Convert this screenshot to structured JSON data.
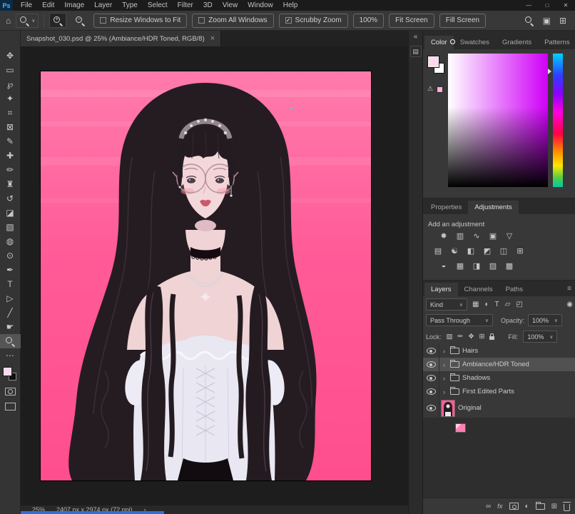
{
  "menubar": {
    "logo": "Ps",
    "items": [
      "File",
      "Edit",
      "Image",
      "Layer",
      "Type",
      "Select",
      "Filter",
      "3D",
      "View",
      "Window",
      "Help"
    ],
    "minimize": "—",
    "maximize": "□",
    "close": "✕"
  },
  "options_bar": {
    "checkboxes": [
      {
        "label": "Resize Windows to Fit",
        "checked": false
      },
      {
        "label": "Zoom All Windows",
        "checked": false
      },
      {
        "label": "Scrubby Zoom",
        "checked": true
      }
    ],
    "zoom_value": "100%",
    "fit_screen": "Fit Screen",
    "fill_screen": "Fill Screen"
  },
  "document_tab": {
    "title": "Snapshot_030.psd @ 25% (Ambiance/HDR Toned, RGB/8)",
    "close_label": "×"
  },
  "status_bar": {
    "zoom": "25%",
    "info": "2407 px x 2974 px (72 ppi)",
    "expander": "›"
  },
  "color_panel": {
    "tabs": [
      "Color",
      "Swatches",
      "Gradients",
      "Patterns"
    ],
    "active_tab": "Color"
  },
  "adjustments_panel": {
    "tabs": [
      "Properties",
      "Adjustments"
    ],
    "active_tab": "Adjustments",
    "header": "Add an adjustment",
    "icons_r1": [
      "✹",
      "▥",
      "∿",
      "▣",
      "▽"
    ],
    "icons_r2": [
      "▤",
      "☯",
      "◧",
      "◩",
      "◫",
      "⊞"
    ],
    "icons_r3": [
      "◒",
      "▦",
      "◨",
      "▨",
      "▩"
    ]
  },
  "layers_panel": {
    "tabs": [
      "Layers",
      "Channels",
      "Paths"
    ],
    "active_tab": "Layers",
    "kind_label": "Kind",
    "blend_mode": "Pass Through",
    "opacity_label": "Opacity:",
    "opacity_value": "100%",
    "lock_label": "Lock:",
    "fill_label": "Fill:",
    "fill_value": "100%",
    "fx_label": "fx",
    "layers": [
      {
        "name": "Hairs",
        "type": "group",
        "visible": true,
        "selected": false
      },
      {
        "name": "Ambiance/HDR Toned",
        "type": "group",
        "visible": true,
        "selected": true
      },
      {
        "name": "Shadows",
        "type": "group",
        "visible": true,
        "selected": false
      },
      {
        "name": "First Edited Parts",
        "type": "group",
        "visible": true,
        "selected": false
      },
      {
        "name": "Original",
        "type": "image",
        "visible": true,
        "selected": false
      }
    ]
  },
  "icons": {
    "home": "⌂",
    "chevron_down": "∨",
    "collapse": "«",
    "collapsed_panel": "▤",
    "ellipsis": "⋯",
    "menu": "≡",
    "check": "✓",
    "plus": "+",
    "minus": "−",
    "move": "✥",
    "marquee": "▭",
    "lasso": "℘",
    "quick_select": "✦",
    "crop": "⌗",
    "frame": "⊠",
    "eyedropper": "✎",
    "healing": "✚",
    "brush": "✏",
    "clone_stamp": "♜",
    "history_brush": "↺",
    "eraser": "◪",
    "gradient": "▧",
    "blur": "◍",
    "dodge": "⊙",
    "pen": "✒",
    "type": "T",
    "path_select": "▷",
    "line": "╱",
    "hand": "☛",
    "warning": "⚠",
    "workspace": "▣",
    "grid": "⊞",
    "filter_pixel": "▦",
    "filter_adjust": "◐",
    "filter_type": "T",
    "filter_shape": "▱",
    "filter_smart": "◰",
    "filter_toggle": "◉",
    "lock_transparent": "▨",
    "lock_pixels": "✏",
    "lock_position": "✥",
    "lock_artboard": "⊞",
    "group_chevron": "›",
    "link": "∞",
    "new_adjustment": "◐",
    "new_layer": "⊞"
  },
  "colors": {
    "accent_blue": "#2e6fd8",
    "canvas_pink": "#ff5e94",
    "foreground_color": "#ffd7ee",
    "selected_layer_bg": "#515151"
  }
}
